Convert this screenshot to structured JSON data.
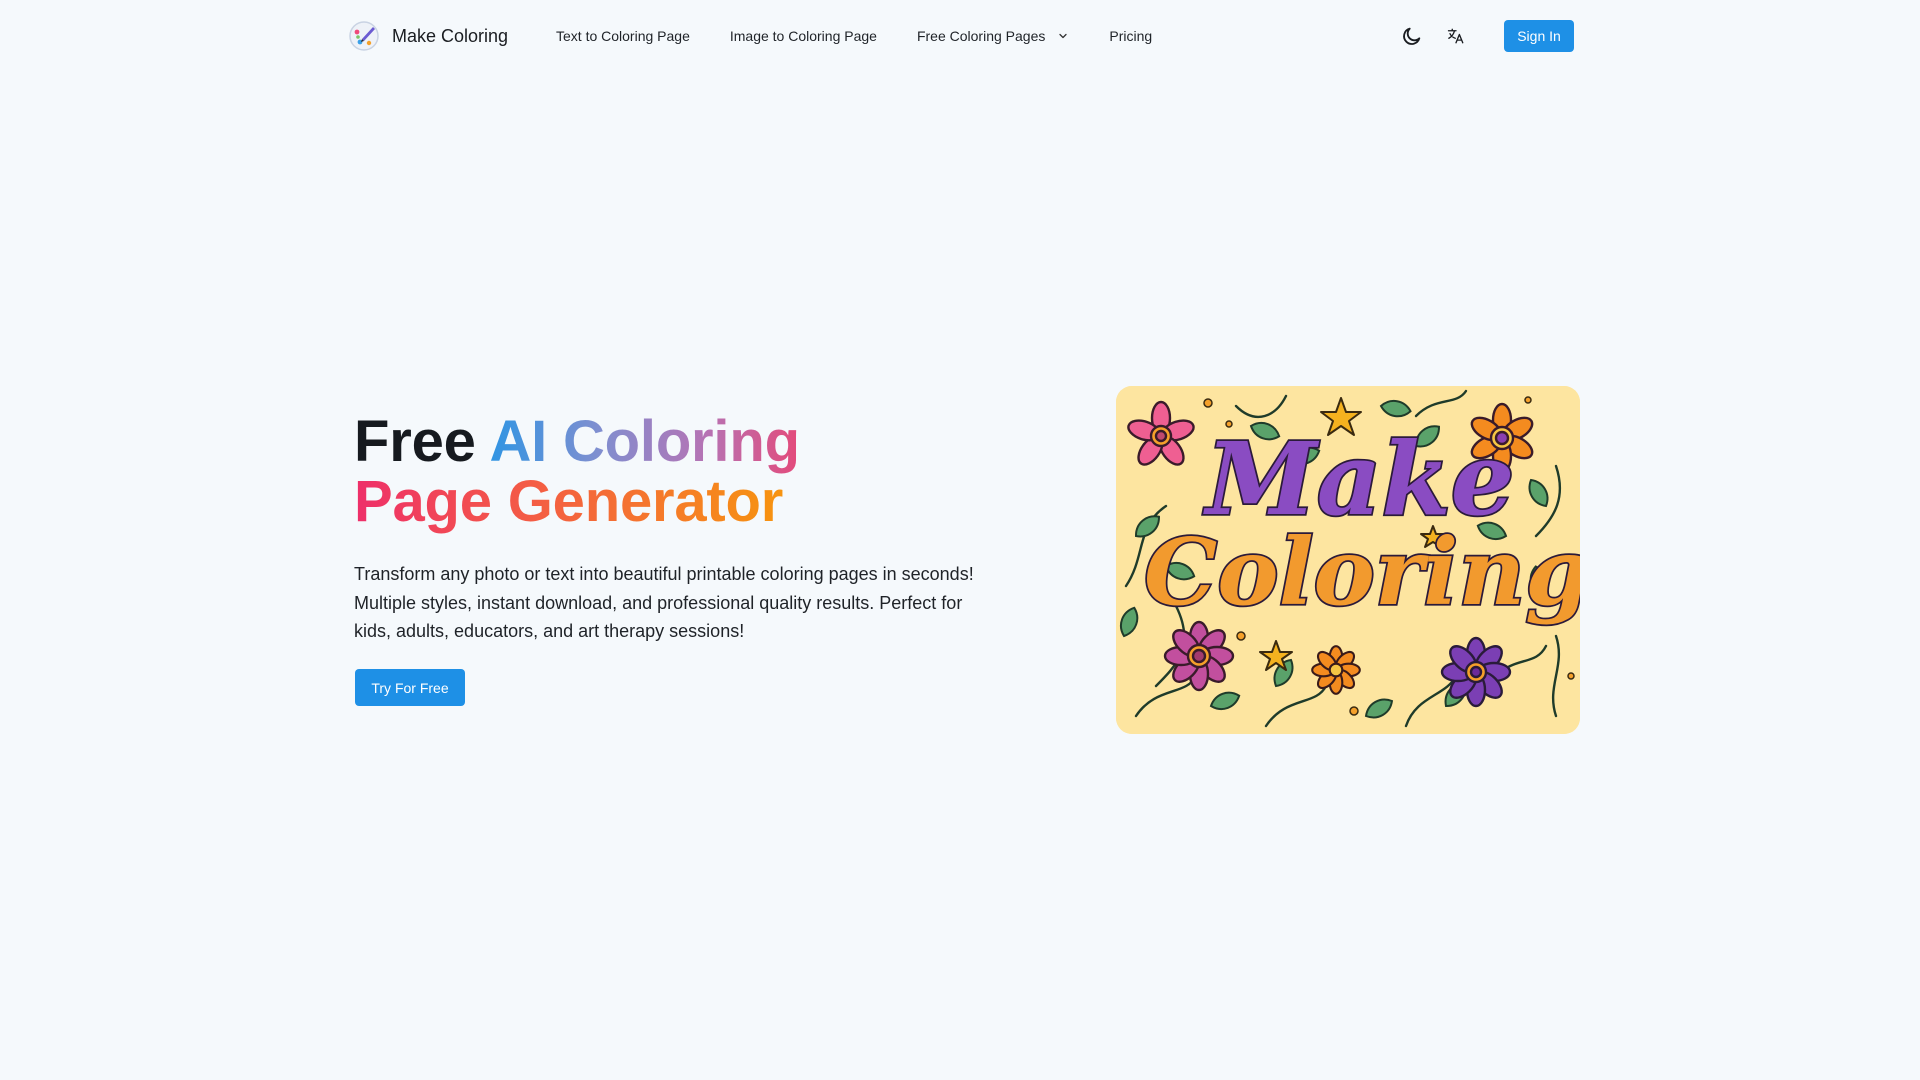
{
  "header": {
    "brand_name": "Make Coloring",
    "brand_icon": "palette-logo-icon",
    "nav": [
      {
        "label": "Text to Coloring Page"
      },
      {
        "label": "Image to Coloring Page"
      },
      {
        "label": "Free Coloring Pages",
        "has_dropdown": true
      },
      {
        "label": "Pricing"
      }
    ],
    "theme_icon": "moon-icon",
    "language_icon": "translate-icon",
    "sign_in_label": "Sign In"
  },
  "hero": {
    "title_plain": "Free ",
    "title_gradient_1": "AI Coloring",
    "title_gradient_2": "Page Generator",
    "description": "Transform any photo or text into beautiful printable coloring pages in seconds! Multiple styles, instant download, and professional quality results. Perfect for kids, adults, educators, and art therapy sessions!",
    "cta_label": "Try For Free",
    "image": {
      "line1": "Make",
      "line2": "Coloring"
    }
  },
  "colors": {
    "background": "#f5f9fc",
    "primary_button": "#1e90e6",
    "image_background": "#fde5a0"
  }
}
